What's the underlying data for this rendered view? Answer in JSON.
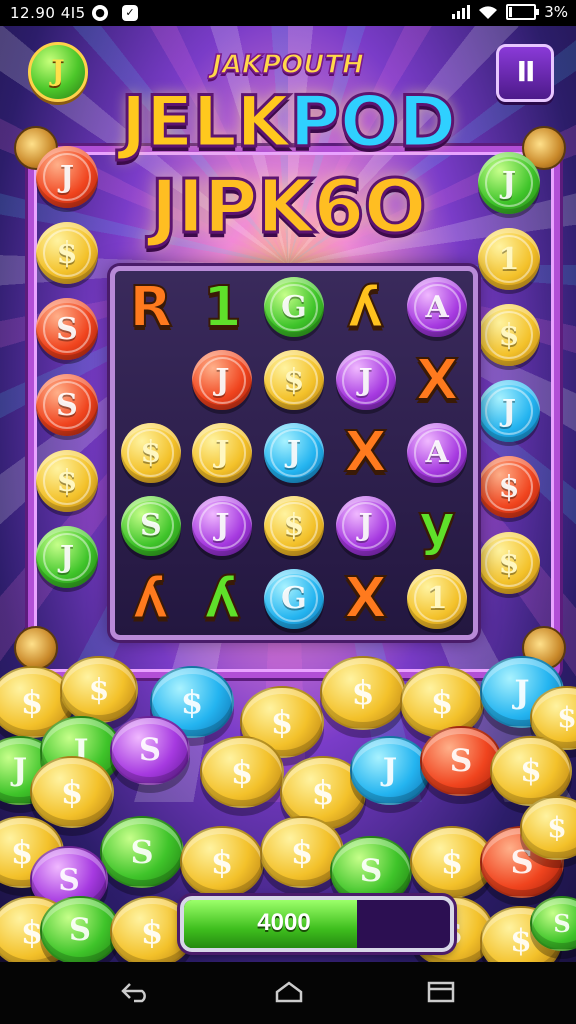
{
  "status_bar": {
    "time": "12.90 4I5",
    "battery": "3%"
  },
  "game": {
    "subtitle": "JAKPOUTH",
    "title_line1_part1": "JELK",
    "title_line1_part2": "POD",
    "title_line2": "JIPK6O",
    "top_left_coin": "J",
    "pause_label": "II",
    "reels": [
      [
        {
          "t": "letter",
          "v": "R",
          "c": "red"
        },
        {
          "t": "letter",
          "v": "1",
          "c": "green"
        },
        {
          "t": "coin",
          "v": "G",
          "c": "green"
        },
        {
          "t": "letter",
          "v": "ʎ",
          "c": "gold"
        },
        {
          "t": "coin",
          "v": "A",
          "c": "purple"
        }
      ],
      [
        {
          "t": "empty",
          "v": "",
          "c": ""
        },
        {
          "t": "coin",
          "v": "J",
          "c": "red"
        },
        {
          "t": "coin",
          "v": "$",
          "c": "gold"
        },
        {
          "t": "coin",
          "v": "J",
          "c": "purple"
        },
        {
          "t": "letter",
          "v": "X",
          "c": "red"
        }
      ],
      [
        {
          "t": "coin",
          "v": "$",
          "c": "gold"
        },
        {
          "t": "coin",
          "v": "J",
          "c": "gold"
        },
        {
          "t": "coin",
          "v": "J",
          "c": "blue"
        },
        {
          "t": "letter",
          "v": "X",
          "c": "red"
        },
        {
          "t": "coin",
          "v": "A",
          "c": "purple"
        }
      ],
      [
        {
          "t": "coin",
          "v": "S",
          "c": "green"
        },
        {
          "t": "coin",
          "v": "J",
          "c": "purple"
        },
        {
          "t": "coin",
          "v": "$",
          "c": "gold"
        },
        {
          "t": "coin",
          "v": "J",
          "c": "purple"
        },
        {
          "t": "letter",
          "v": "y",
          "c": "green"
        }
      ],
      [
        {
          "t": "letter",
          "v": "ʎ",
          "c": "red"
        },
        {
          "t": "letter",
          "v": "ʎ",
          "c": "green"
        },
        {
          "t": "coin",
          "v": "G",
          "c": "blue"
        },
        {
          "t": "letter",
          "v": "X",
          "c": "red"
        },
        {
          "t": "coin",
          "v": "1",
          "c": "gold"
        }
      ]
    ],
    "left_coins": [
      {
        "v": "J",
        "c": "red"
      },
      {
        "v": "$",
        "c": "gold"
      },
      {
        "v": "S",
        "c": "red"
      },
      {
        "v": "S",
        "c": "red"
      },
      {
        "v": "$",
        "c": "gold"
      },
      {
        "v": "J",
        "c": "green"
      }
    ],
    "right_coins": [
      {
        "v": "J",
        "c": "green"
      },
      {
        "v": "1",
        "c": "gold"
      },
      {
        "v": "$",
        "c": "gold"
      },
      {
        "v": "J",
        "c": "blue"
      },
      {
        "v": "$",
        "c": "red"
      },
      {
        "v": "$",
        "c": "gold"
      }
    ],
    "progress": {
      "value_text": "4000",
      "fraction": 0.65
    }
  },
  "colors": {
    "gold": "#f3c12a",
    "green": "#3fc42a",
    "red": "#f0441e",
    "blue": "#24b4f0",
    "purple": "#a63ae0"
  },
  "nav_icons": [
    "back-icon",
    "home-icon",
    "recents-icon"
  ]
}
